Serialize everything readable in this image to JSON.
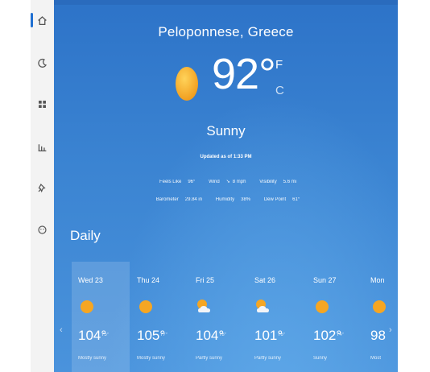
{
  "current": {
    "location": "Peloponnese, Greece",
    "temperature": "92°",
    "unit_f": "F",
    "unit_c": "C",
    "condition": "Sunny",
    "updated": "Updated as of 1:33 PM",
    "details": {
      "feels_like_label": "Feels Like",
      "feels_like_value": "96°",
      "wind_label": "Wind",
      "wind_value": "8 mph",
      "visibility_label": "Visibility",
      "visibility_value": "5.6 mi",
      "barometer_label": "Barometer",
      "barometer_value": "29.84 in",
      "humidity_label": "Humidity",
      "humidity_value": "38%",
      "dew_point_label": "Dew Point",
      "dew_point_value": "61°"
    }
  },
  "daily": {
    "label": "Daily",
    "days": [
      {
        "day": "Wed 23",
        "icon": "sun-icon",
        "hi": "104°",
        "lo": "75°",
        "desc": "Mostly sunny"
      },
      {
        "day": "Thu 24",
        "icon": "sun-icon",
        "hi": "105°",
        "lo": "77°",
        "desc": "Mostly sunny"
      },
      {
        "day": "Fri 25",
        "icon": "partly-sunny-icon",
        "hi": "104°",
        "lo": "78°",
        "desc": "Partly sunny"
      },
      {
        "day": "Sat 26",
        "icon": "partly-sunny-icon",
        "hi": "101°",
        "lo": "76°",
        "desc": "Partly sunny"
      },
      {
        "day": "Sun 27",
        "icon": "sun-icon",
        "hi": "102°",
        "lo": "74°",
        "desc": "Sunny"
      },
      {
        "day": "Mon",
        "icon": "sun-icon",
        "hi": "98",
        "lo": "",
        "desc": "Most"
      }
    ]
  },
  "nav": {
    "icons": [
      "home-icon",
      "moon-icon",
      "grid-icon",
      "chart-icon",
      "pin-icon",
      "emoji-icon"
    ]
  },
  "colors": {
    "accent": "#1f6fd1",
    "sun": "#f5a623",
    "background_top": "#2d73c8",
    "background_bottom": "#4a93dc"
  }
}
